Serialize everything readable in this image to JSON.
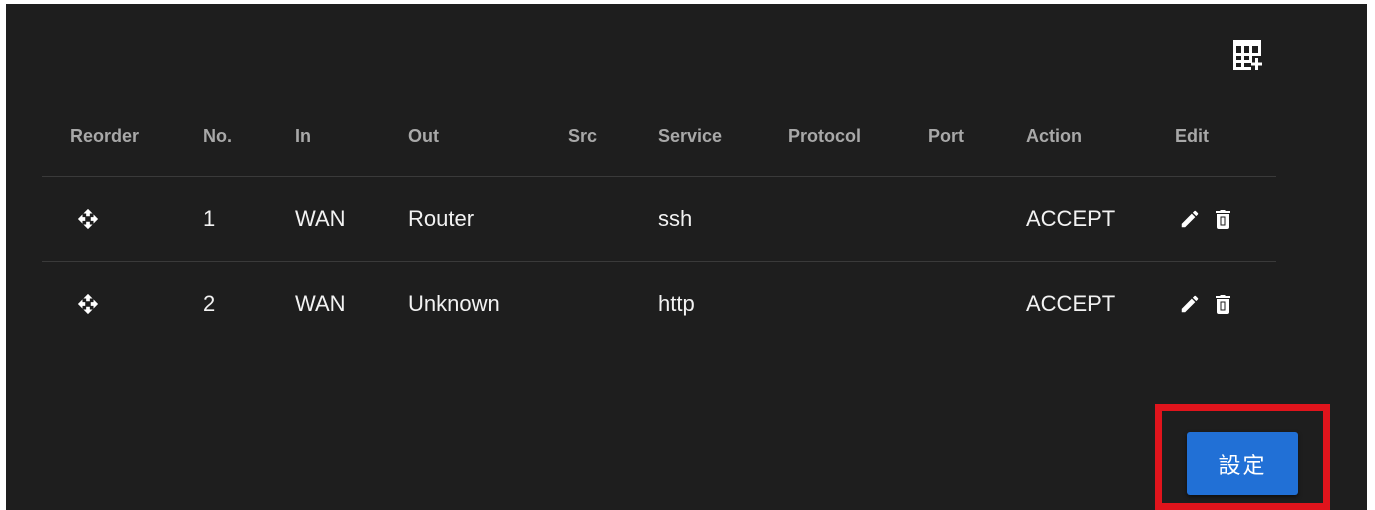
{
  "toolbar": {
    "add_row_icon": "table-add-icon"
  },
  "table": {
    "headers": {
      "reorder": "Reorder",
      "no": "No.",
      "in": "In",
      "out": "Out",
      "src": "Src",
      "service": "Service",
      "protocol": "Protocol",
      "port": "Port",
      "action": "Action",
      "edit": "Edit"
    },
    "rows": [
      {
        "no": "1",
        "in": "WAN",
        "out": "Router",
        "src": "",
        "service": "ssh",
        "protocol": "",
        "port": "",
        "action": "ACCEPT"
      },
      {
        "no": "2",
        "in": "WAN",
        "out": "Unknown",
        "src": "",
        "service": "http",
        "protocol": "",
        "port": "",
        "action": "ACCEPT"
      }
    ],
    "row_icons": {
      "reorder": "move-icon",
      "edit": "pencil-icon",
      "delete": "trash-icon"
    }
  },
  "footer": {
    "save_label": "設定"
  },
  "colors": {
    "panel_bg": "#1e1e1e",
    "header_text": "#a8a8a8",
    "cell_text": "#f2f2f2",
    "save_button": "#2170d6",
    "highlight_frame": "#e0141c"
  }
}
